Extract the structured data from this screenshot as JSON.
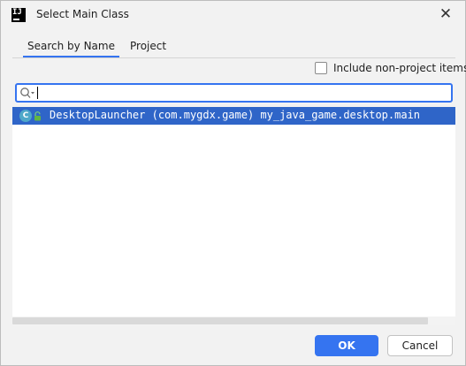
{
  "window": {
    "logo_text": "IJ",
    "title": "Select Main Class",
    "close_glyph": "✕"
  },
  "tabs": [
    {
      "label": "Search by Name",
      "active": true
    },
    {
      "label": "Project",
      "active": false
    }
  ],
  "include_checkbox": {
    "label": "Include non-project items",
    "checked": false
  },
  "search": {
    "value": "",
    "placeholder": ""
  },
  "results": [
    {
      "icon_letter": "C",
      "icon": "class-icon",
      "badge_icon": "lock-icon",
      "text": "DesktopLauncher (com.mygdx.game) my_java_game.desktop.main",
      "selected": true
    }
  ],
  "buttons": {
    "ok_label": "OK",
    "cancel_label": "Cancel"
  },
  "colors": {
    "accent": "#3574f0",
    "selection": "#2f65c8",
    "class_icon": "#4fa8c9"
  }
}
